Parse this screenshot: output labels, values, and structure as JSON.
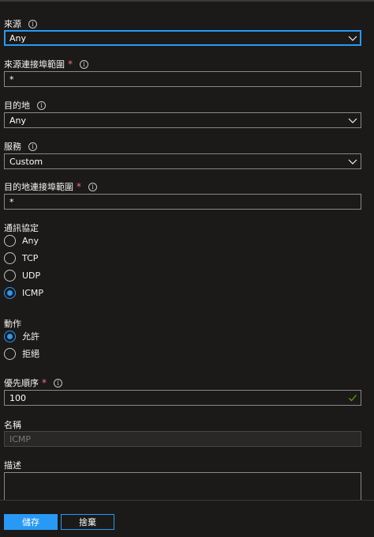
{
  "source": {
    "label": "來源",
    "value": "Any"
  },
  "source_port_ranges": {
    "label": "來源連接埠範圍",
    "value": "*"
  },
  "destination": {
    "label": "目的地",
    "value": "Any"
  },
  "service": {
    "label": "服務",
    "value": "Custom"
  },
  "destination_port_ranges": {
    "label": "目的地連接埠範圍",
    "value": "*"
  },
  "protocol": {
    "label": "通訊協定",
    "options": [
      "Any",
      "TCP",
      "UDP",
      "ICMP"
    ],
    "selected": "ICMP"
  },
  "action": {
    "label": "動作",
    "options": [
      "允許",
      "拒絕"
    ],
    "selected": "允許"
  },
  "priority": {
    "label": "優先順序",
    "value": "100"
  },
  "name": {
    "label": "名稱",
    "value": "ICMP"
  },
  "description": {
    "label": "描述",
    "value": ""
  },
  "required_marker": "*",
  "info_glyph": "i",
  "footer": {
    "save_label": "儲存",
    "discard_label": "捨棄"
  },
  "colors": {
    "accent": "#2899f5",
    "required": "#f1707b",
    "valid_check": "#57a300",
    "background": "#1b1a19"
  }
}
